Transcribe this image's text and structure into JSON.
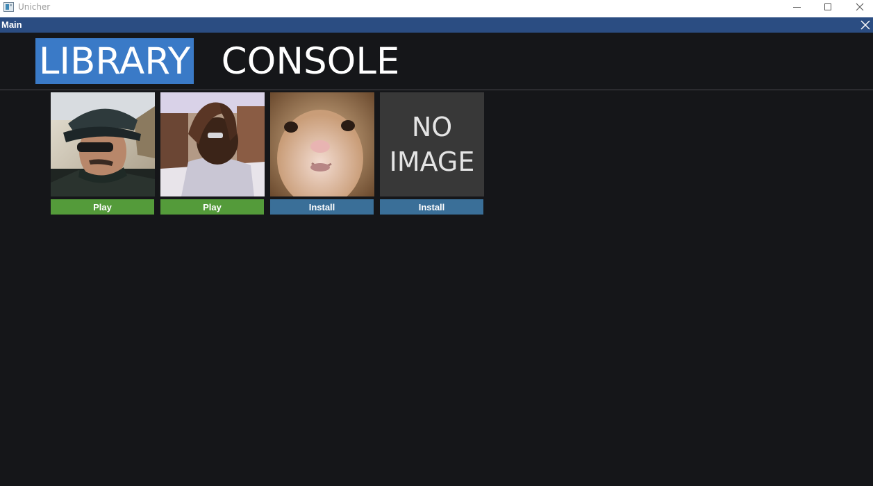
{
  "window": {
    "title": "Unicher"
  },
  "inner_window": {
    "title": "Main"
  },
  "tabs": [
    {
      "label": "LIBRARY",
      "active": true
    },
    {
      "label": "CONSOLE",
      "active": false
    }
  ],
  "games": [
    {
      "image": "man-in-cap-and-sunglasses",
      "action": "Play"
    },
    {
      "image": "man-hands-on-head",
      "action": "Play"
    },
    {
      "image": "hamster-face-closeup",
      "action": "Install"
    },
    {
      "image": "no-image-placeholder",
      "placeholder_line1": "NO",
      "placeholder_line2": "IMAGE",
      "action": "Install"
    }
  ],
  "colors": {
    "background": "#151619",
    "active_tab": "#3a7ac7",
    "inner_titlebar": "#2b4d82",
    "play_button": "#549b3a",
    "install_button": "#3a6f98"
  }
}
